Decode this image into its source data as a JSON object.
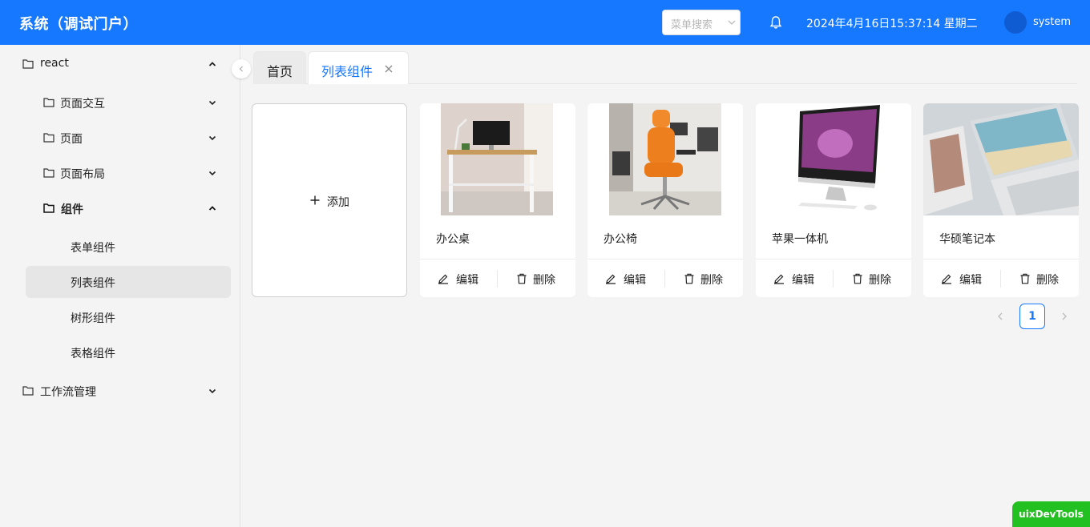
{
  "header": {
    "title": "系统（调试门户）",
    "menu_search_placeholder": "菜单搜索",
    "datetime": "2024年4月16日15:37:14 星期二",
    "username": "system"
  },
  "sidebar": {
    "items": [
      {
        "label": "react"
      },
      {
        "label": "页面交互"
      },
      {
        "label": "页面"
      },
      {
        "label": "页面布局"
      },
      {
        "label": "组件"
      },
      {
        "label": "表单组件"
      },
      {
        "label": "列表组件"
      },
      {
        "label": "树形组件"
      },
      {
        "label": "表格组件"
      },
      {
        "label": "工作流管理"
      }
    ]
  },
  "tabs": [
    {
      "label": "首页"
    },
    {
      "label": "列表组件"
    }
  ],
  "add_card": {
    "label": "添加"
  },
  "cards": [
    {
      "title": "办公桌",
      "edit": "编辑",
      "delete": "删除"
    },
    {
      "title": "办公椅",
      "edit": "编辑",
      "delete": "删除"
    },
    {
      "title": "苹果一体机",
      "edit": "编辑",
      "delete": "删除"
    },
    {
      "title": "华硕笔记本",
      "edit": "编辑",
      "delete": "删除"
    }
  ],
  "pagination": {
    "current": "1"
  },
  "devtools": {
    "label": "uixDevTools"
  },
  "colors": {
    "primary": "#1677ff",
    "devtools": "#22c020"
  }
}
